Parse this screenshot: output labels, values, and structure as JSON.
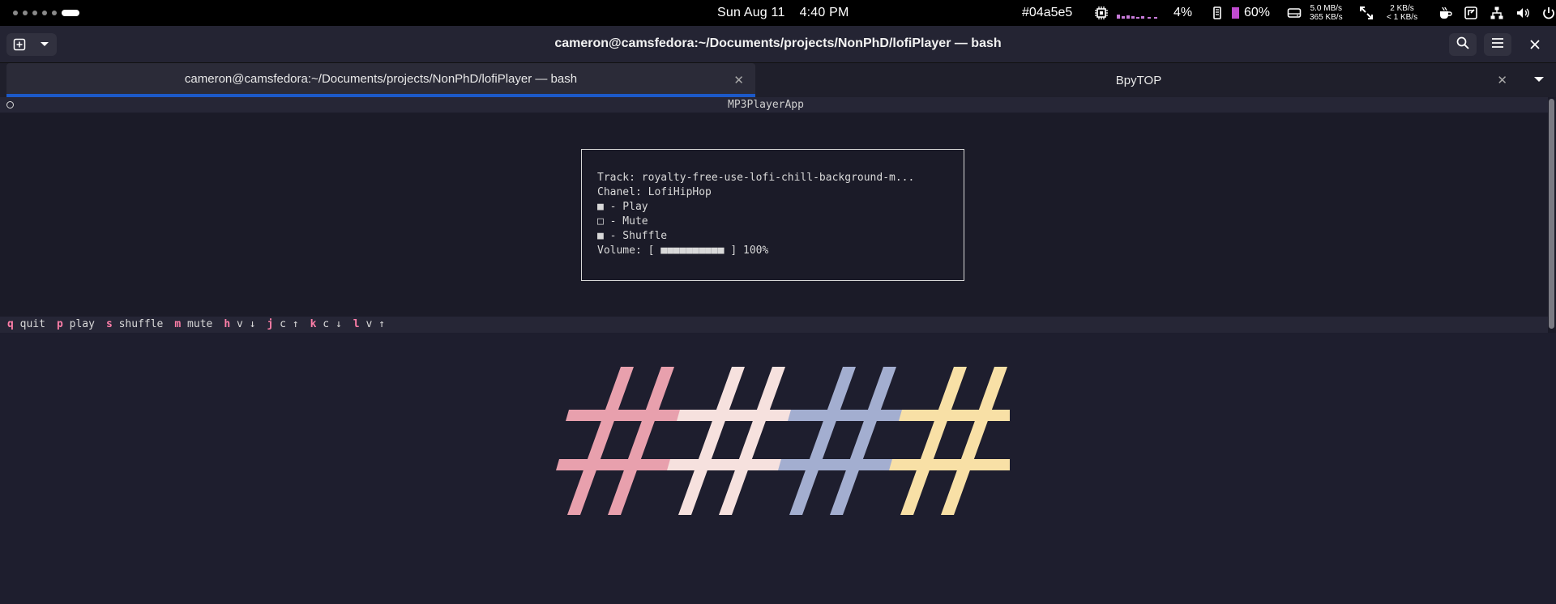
{
  "topbar": {
    "date": "Sun Aug 11",
    "time": "4:40 PM",
    "hex": "#04a5e5",
    "cpu_percent": "4%",
    "battery_percent": "60%",
    "disk_read": "5.0 MB/s",
    "disk_write": "365 KB/s",
    "net_down": "2 KB/s",
    "net_up": "< 1 KB/s",
    "icons": [
      "workspace-dots",
      "cpu-icon",
      "memory-icon",
      "disk-icon",
      "fullscreen-icon",
      "coffee-icon",
      "screen-share-icon",
      "network-icon",
      "volume-icon",
      "power-icon"
    ]
  },
  "window": {
    "title": "cameron@camsfedora:~/Documents/projects/NonPhD/lofiPlayer — bash"
  },
  "tabs": [
    {
      "label": "cameron@camsfedora:~/Documents/projects/NonPhD/lofiPlayer — bash",
      "active": true
    },
    {
      "label": "BpyTOP",
      "active": false
    }
  ],
  "app": {
    "title": "MP3PlayerApp",
    "track_line": "Track: royalty-free-use-lofi-chill-background-m...",
    "channel_line": "Chanel: LofiHipHop",
    "play_line": "■ - Play",
    "mute_line": "□ - Mute",
    "shuffle_line": "■ - Shuffle",
    "volume_line": "Volume: [ ■■■■■■■■■■ ] 100%",
    "volume_level": 1.0
  },
  "keybinds": [
    {
      "key": "q",
      "label": "quit"
    },
    {
      "key": "p",
      "label": "play"
    },
    {
      "key": "s",
      "label": "shuffle"
    },
    {
      "key": "m",
      "label": "mute"
    },
    {
      "key": "h",
      "label": "v ↓"
    },
    {
      "key": "j",
      "label": "c ↑"
    },
    {
      "key": "k",
      "label": "c ↓"
    },
    {
      "key": "l",
      "label": "v ↑"
    }
  ],
  "wallpaper": {
    "colors": [
      "#e8a0ad",
      "#f6e1de",
      "#a3aed0",
      "#f8e0a6"
    ]
  }
}
